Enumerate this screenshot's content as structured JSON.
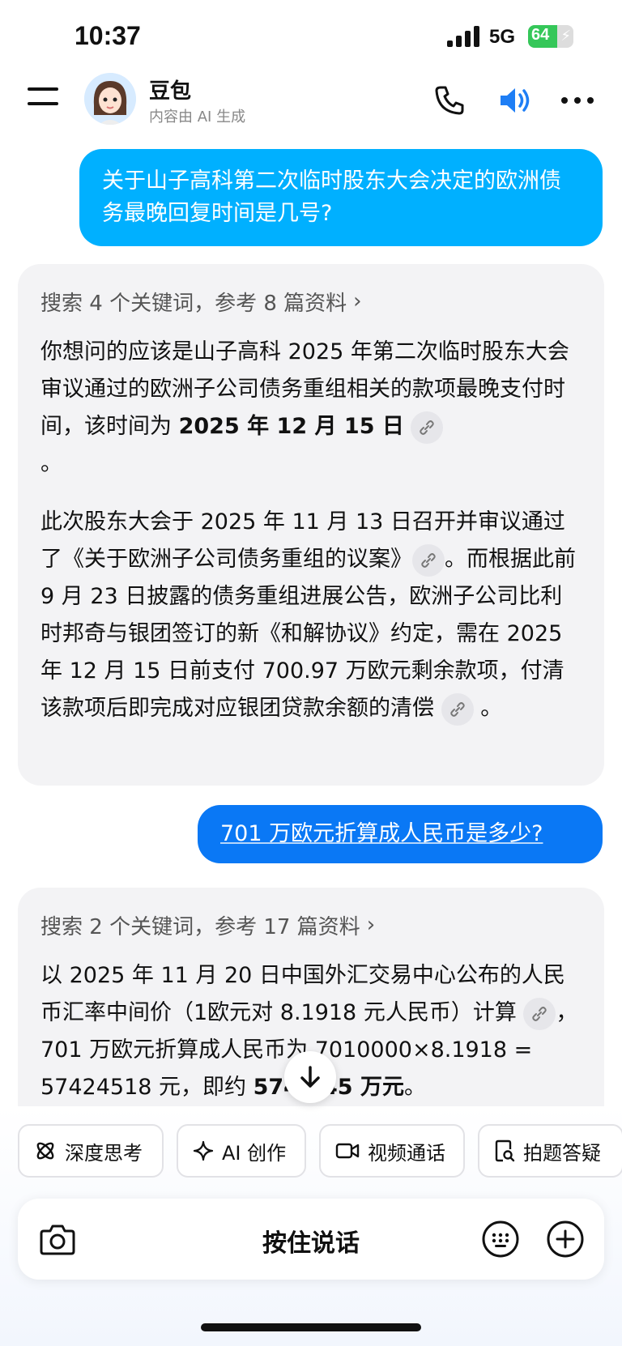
{
  "status_bar": {
    "time": "10:37",
    "network": "5G",
    "battery": "64",
    "battery_level": 0.64
  },
  "header": {
    "bot_name": "豆包",
    "bot_subtitle": "内容由 AI 生成"
  },
  "messages": [
    {
      "role": "user",
      "text": "关于山子高科第二次临时股东大会决定的欧洲债务最晚回复时间是几号?"
    },
    {
      "role": "assistant",
      "search_summary": "搜索 4 个关键词，参考 8 篇资料",
      "p1_text": "你想问的应该是山子高科 2025 年第二次临时股东大会审议通过的欧洲子公司债务重组相关的款项最晚支付时间，该时间为 ",
      "p1_bold": "2025 年 12 月 15 日",
      "p1_end": "。",
      "p2_a": "此次股东大会于 2025 年 11 月 13 日召开并审议通过了《关于欧洲子公司债务重组的议案》",
      "p2_b": "。而根据此前 9 月 23 日披露的债务重组进展公告，欧洲子公司比利时邦奇与银团签订的新《和解协议》约定，需在 2025 年 12 月 15 日前支付 700.97 万欧元剩余款项，付清该款项后即完成对应银团贷款余额的清偿",
      "p2_end": "。"
    },
    {
      "role": "user",
      "text": "701 万欧元折算成人民币是多少?"
    },
    {
      "role": "assistant",
      "search_summary": "搜索 2 个关键词，参考 17 篇资料",
      "p1_a": "以 2025 年 11 月 20 日中国外汇交易中心公布的人民币汇率中间价（1欧元对 8.1918 元人民币）计算",
      "p1_b": "，701 万欧元折算成人民币为 7010000×8.1918 = 57424518 元，即约 ",
      "p1_bold": "5742.45 万元",
      "p1_end": "。"
    }
  ],
  "quick_actions": [
    "深度思考",
    "AI 创作",
    "视频通话",
    "拍题答疑"
  ],
  "input": {
    "hold_to_talk": "按住说话"
  },
  "icons": [
    "menu-icon",
    "phone-icon",
    "speaker-icon",
    "more-icon",
    "link-icon",
    "scroll-down-icon",
    "camera-icon",
    "keyboard-icon",
    "plus-icon"
  ],
  "colors": {
    "user_bubble_1": "#00b0ff",
    "user_bubble_2": "#0a78f5",
    "accent_speaker": "#1e7ef5",
    "battery": "#35c759"
  }
}
